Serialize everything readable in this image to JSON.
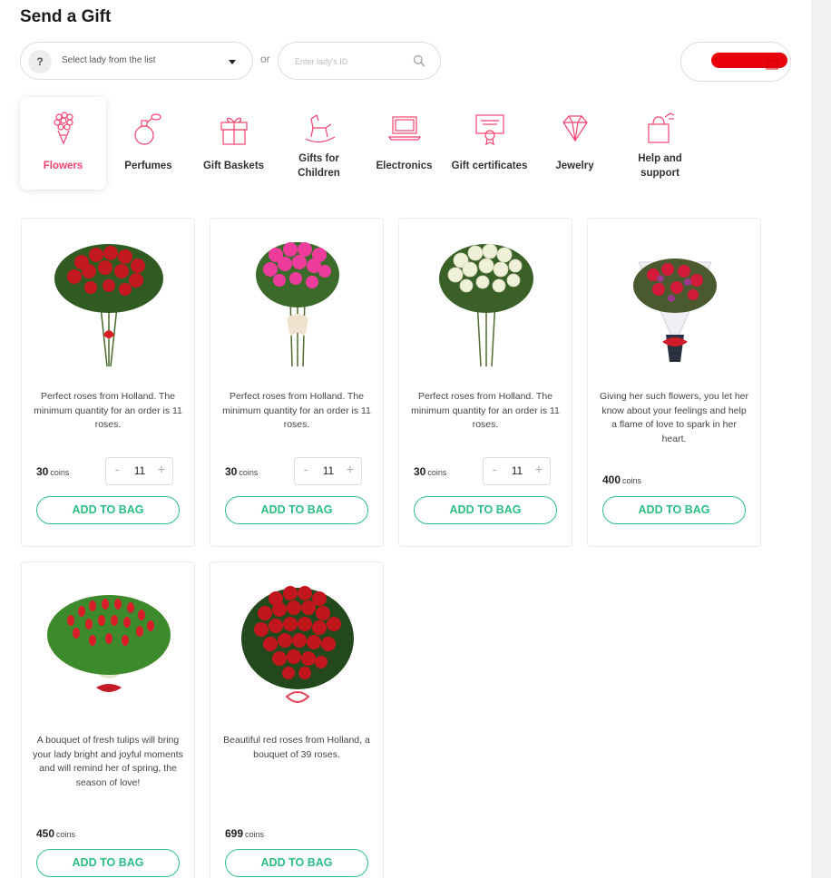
{
  "page": {
    "title": "Send a Gift"
  },
  "search": {
    "help_glyph": "?",
    "select_placeholder": "Select lady from the list",
    "or": "or",
    "id_placeholder": "Enter lady's ID"
  },
  "categories": [
    {
      "label": "Flowers",
      "icon": "bouquet-icon",
      "active": true
    },
    {
      "label": "Perfumes",
      "icon": "perfume-bottle-icon"
    },
    {
      "label": "Gift Baskets",
      "icon": "gift-box-icon"
    },
    {
      "label": "Gifts for Children",
      "icon": "rocking-horse-icon"
    },
    {
      "label": "Electronics",
      "icon": "laptop-icon"
    },
    {
      "label": "Gift certificates",
      "icon": "certificate-icon"
    },
    {
      "label": "Jewelry",
      "icon": "diamond-icon"
    },
    {
      "label": "Help and support",
      "icon": "shopping-bag-icon"
    }
  ],
  "products": [
    {
      "desc": "Perfect roses from Holland. The minimum quantity for an order is 11 roses.",
      "price": "30",
      "unit": "coins",
      "qty": "11",
      "minus": "-",
      "plus": "+",
      "button": "ADD TO BAG",
      "image": "red-roses-bouquet"
    },
    {
      "desc": "Perfect roses from Holland. The minimum quantity for an order is 11 roses.",
      "price": "30",
      "unit": "coins",
      "qty": "11",
      "minus": "-",
      "plus": "+",
      "button": "ADD TO BAG",
      "image": "pink-roses-bouquet"
    },
    {
      "desc": "Perfect roses from Holland. The minimum quantity for an order is 11 roses.",
      "price": "30",
      "unit": "coins",
      "qty": "11",
      "minus": "-",
      "plus": "+",
      "button": "ADD TO BAG",
      "image": "white-roses-bouquet"
    },
    {
      "desc": "Giving her such flowers, you let her know about your feelings and help a flame of love to spark in her heart.",
      "price": "400",
      "unit": "coins",
      "button": "ADD TO BAG",
      "image": "mixed-bouquet"
    },
    {
      "desc": "A bouquet of fresh tulips will bring your lady bright and joyful moments and will remind her of spring, the season of love!",
      "price": "450",
      "unit": "coins",
      "button": "ADD TO BAG",
      "image": "red-tulips-bouquet"
    },
    {
      "desc": "Beautiful red roses from Holland, a bouquet of 39 roses.",
      "price": "699",
      "unit": "coins",
      "button": "ADD TO BAG",
      "image": "39-red-roses-bouquet"
    }
  ],
  "colors": {
    "accent_pink": "#f2426f",
    "accent_green": "#2cbf84",
    "redacted": "#e8000c"
  }
}
